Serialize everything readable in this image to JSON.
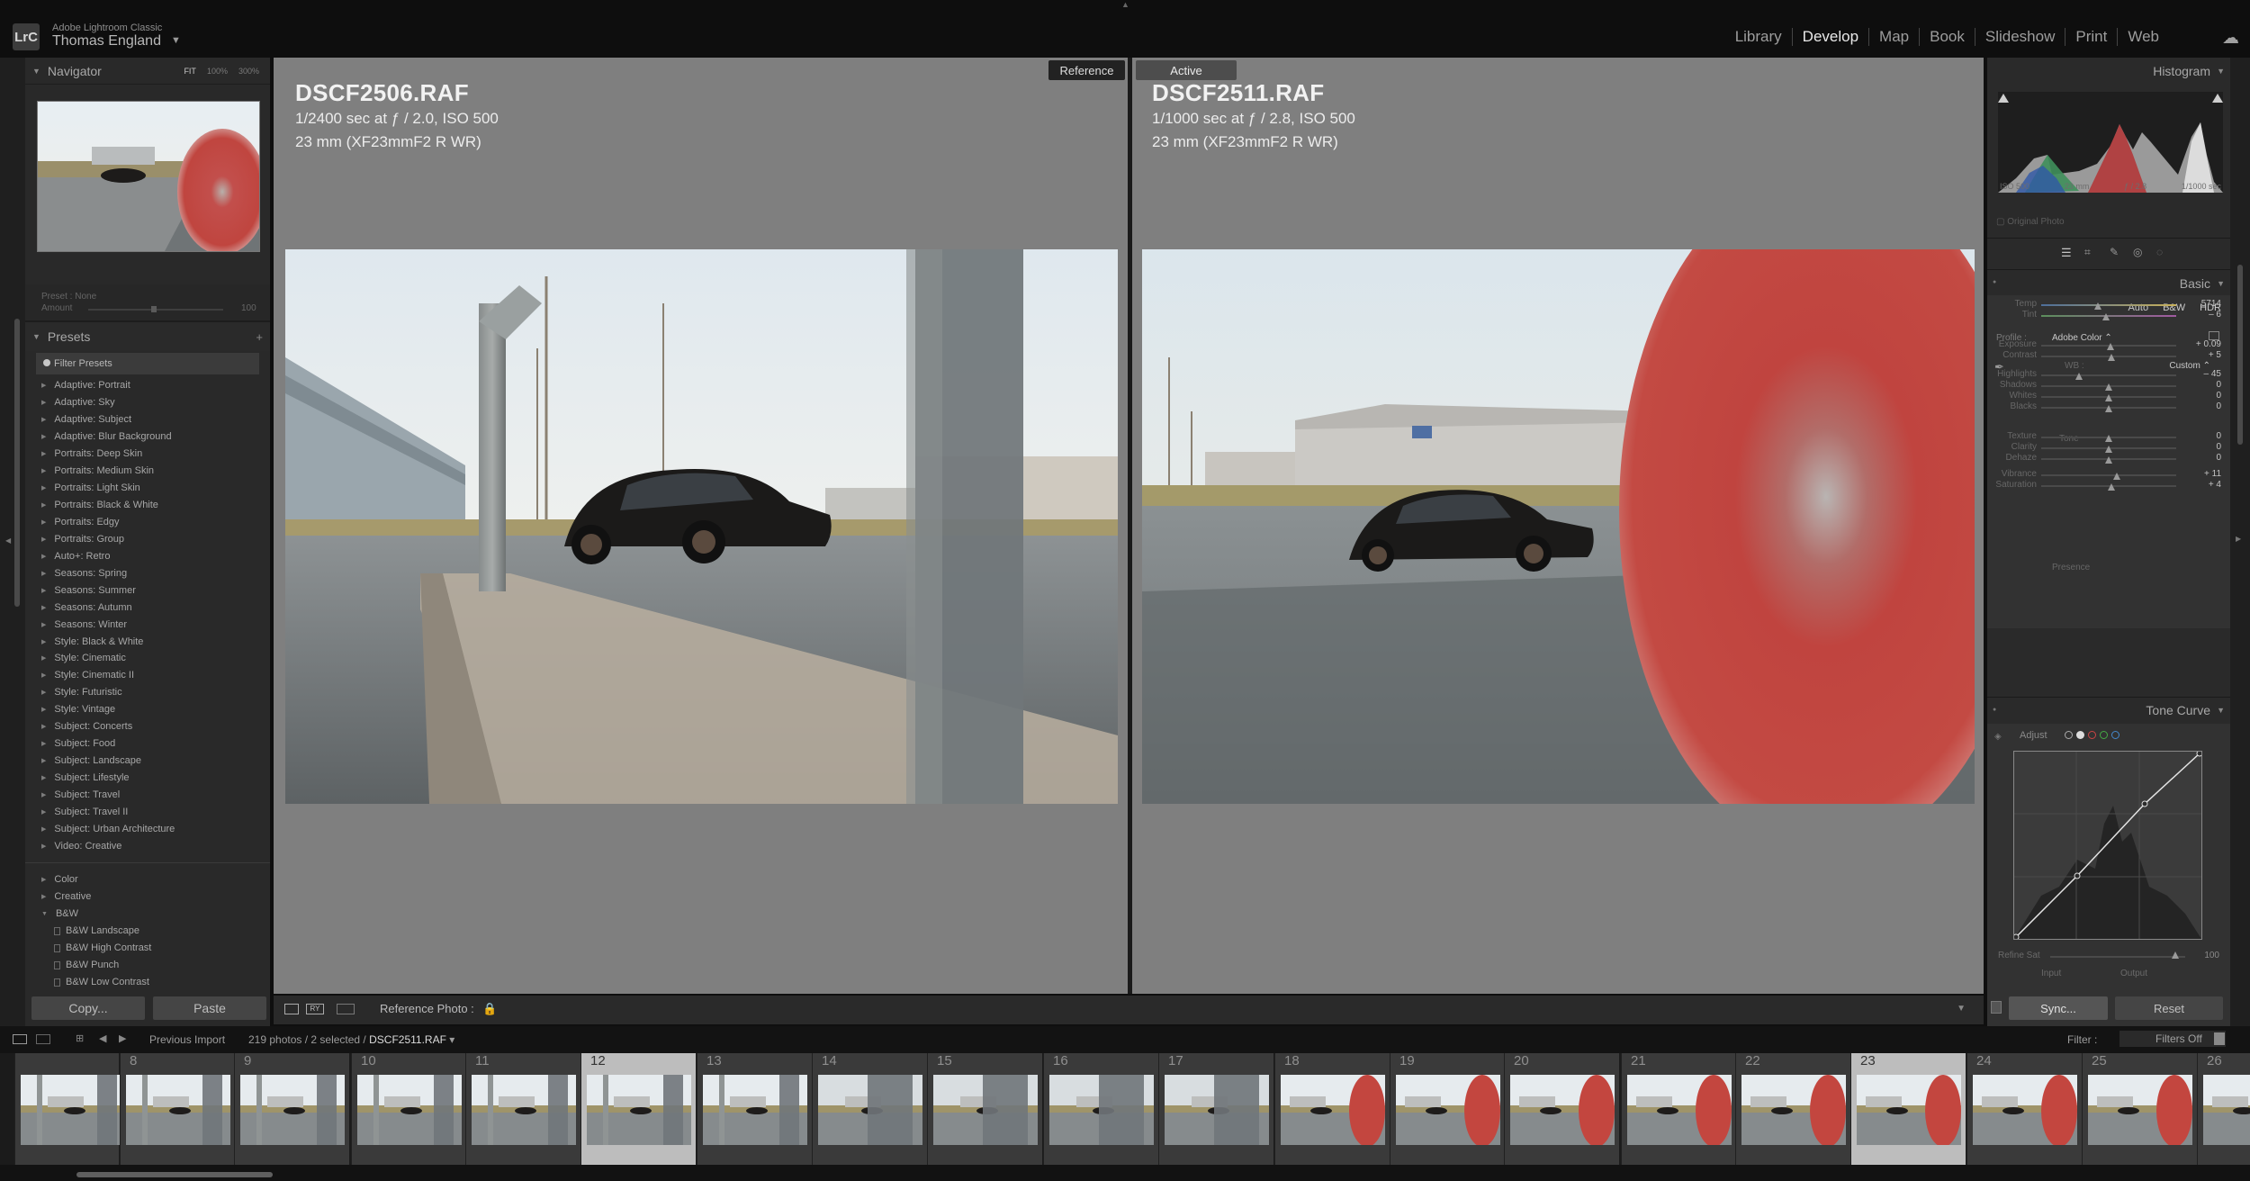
{
  "app": {
    "name": "Adobe Lightroom Classic",
    "logo": "LrC",
    "user": "Thomas England"
  },
  "modules": [
    {
      "label": "Library",
      "active": false
    },
    {
      "label": "Develop",
      "active": true
    },
    {
      "label": "Map",
      "active": false
    },
    {
      "label": "Book",
      "active": false
    },
    {
      "label": "Slideshow",
      "active": false
    },
    {
      "label": "Print",
      "active": false
    },
    {
      "label": "Web",
      "active": false
    }
  ],
  "navigator": {
    "title": "Navigator",
    "zoom": [
      "FIT",
      "100%",
      "300%"
    ]
  },
  "preset_info": {
    "preset_label": "Preset :",
    "preset_value": "None",
    "amount_label": "Amount",
    "amount_value": "100"
  },
  "presets": {
    "title": "Presets",
    "filter": "Filter Presets",
    "items": [
      "Adaptive: Portrait",
      "Adaptive: Sky",
      "Adaptive: Subject",
      "Adaptive: Blur Background",
      "Portraits: Deep Skin",
      "Portraits: Medium Skin",
      "Portraits: Light Skin",
      "Portraits: Black & White",
      "Portraits: Edgy",
      "Portraits: Group",
      "Auto+: Retro",
      "Seasons: Spring",
      "Seasons: Summer",
      "Seasons: Autumn",
      "Seasons: Winter",
      "Style: Black & White",
      "Style: Cinematic",
      "Style: Cinematic II",
      "Style: Futuristic",
      "Style: Vintage",
      "Subject: Concerts",
      "Subject: Food",
      "Subject: Landscape",
      "Subject: Lifestyle",
      "Subject: Travel",
      "Subject: Travel II",
      "Subject: Urban Architecture",
      "Video: Creative"
    ],
    "groups": [
      "Color",
      "Creative",
      "B&W"
    ],
    "bw_items": [
      "B&W Landscape",
      "B&W High Contrast",
      "B&W Punch",
      "B&W Low Contrast"
    ]
  },
  "buttons": {
    "copy": "Copy...",
    "paste": "Paste",
    "sync": "Sync...",
    "reset": "Reset"
  },
  "reference": {
    "tag": "Reference",
    "filename": "DSCF2506.RAF",
    "exposure": "1/2400 sec at ƒ / 2.0, ISO 500",
    "lens": "23 mm (XF23mmF2 R WR)"
  },
  "active": {
    "tag": "Active",
    "filename": "DSCF2511.RAF",
    "exposure": "1/1000 sec at ƒ / 2.8, ISO 500",
    "lens": "23 mm (XF23mmF2 R WR)"
  },
  "toolbar": {
    "reference_photo": "Reference Photo :"
  },
  "histogram": {
    "title": "Histogram",
    "iso": "ISO 500",
    "focal": "23 mm",
    "aperture": "ƒ / 2.8",
    "shutter": "1/1000 sec",
    "original": "Original Photo"
  },
  "basic": {
    "title": "Basic",
    "buttons": [
      "Auto",
      "B&W",
      "HDR"
    ],
    "profile_label": "Profile :",
    "profile_value": "Adobe Color",
    "wb_label": "WB :",
    "wb_value": "Custom",
    "tone_label": "Tone",
    "presence_label": "Presence",
    "sliders": [
      {
        "label": "Temp",
        "value": "5714",
        "pos": 0.42
      },
      {
        "label": "Tint",
        "value": "– 6",
        "pos": 0.48
      },
      {
        "label": "Exposure",
        "value": "+ 0.09",
        "pos": 0.51
      },
      {
        "label": "Contrast",
        "value": "+ 5",
        "pos": 0.52
      },
      {
        "label": "Highlights",
        "value": "– 45",
        "pos": 0.28
      },
      {
        "label": "Shadows",
        "value": "0",
        "pos": 0.5
      },
      {
        "label": "Whites",
        "value": "0",
        "pos": 0.5
      },
      {
        "label": "Blacks",
        "value": "0",
        "pos": 0.5
      },
      {
        "label": "Texture",
        "value": "0",
        "pos": 0.5
      },
      {
        "label": "Clarity",
        "value": "0",
        "pos": 0.5
      },
      {
        "label": "Dehaze",
        "value": "0",
        "pos": 0.5
      },
      {
        "label": "Vibrance",
        "value": "+ 11",
        "pos": 0.56
      },
      {
        "label": "Saturation",
        "value": "+ 4",
        "pos": 0.52
      }
    ]
  },
  "tone_curve": {
    "title": "Tone Curve",
    "adjust": "Adjust",
    "refine_sat": "Refine Sat",
    "refine_value": "100",
    "input": "Input",
    "output": "Output"
  },
  "filmstrip_bar": {
    "source": "Previous Import",
    "count": "219 photos / 2 selected /",
    "file": "DSCF2511.RAF",
    "filter_label": "Filter :",
    "filter_value": "Filters Off"
  },
  "filmstrip": {
    "numbers": [
      "",
      "8",
      "9",
      "10",
      "11",
      "12",
      "13",
      "14",
      "15",
      "16",
      "17",
      "18",
      "19",
      "20",
      "21",
      "22",
      "23",
      "24",
      "25",
      "26"
    ],
    "selected": [
      "12",
      "23"
    ]
  },
  "colors": {
    "accent_selected": "#bdbdbd",
    "background": "#7f7f7f",
    "panel": "#2a2a2a"
  }
}
